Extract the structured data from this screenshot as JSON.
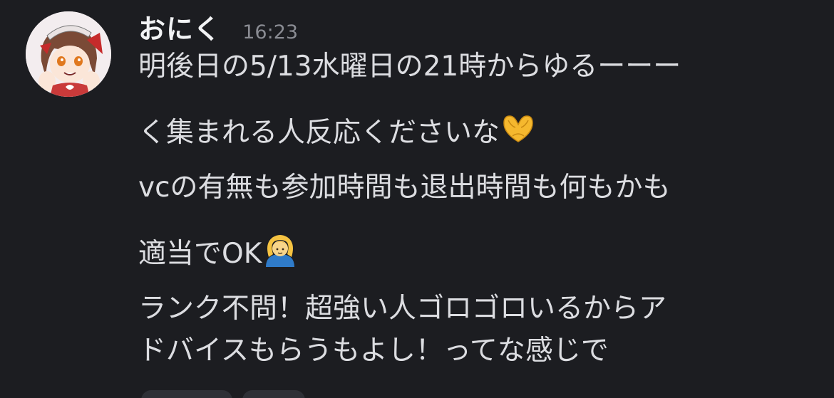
{
  "message": {
    "username": "おにく",
    "timestamp": "16:23",
    "lines": [
      {
        "text": "明後日の5/13水曜日の21時からゆるーーー",
        "emoji": ""
      },
      {
        "text": "く集まれる人反応くださいな",
        "emoji": "heart-hands-emoji"
      },
      {
        "text": "vcの有無も参加時間も退出時間も何もかも",
        "emoji": ""
      },
      {
        "text": "適当でOK",
        "emoji": "person-gesturing-ok-emoji"
      },
      {
        "text": "ランク不問！超強い人ゴロゴロいるからア",
        "emoji": ""
      },
      {
        "text": "ドバイスもらうもよし！ってな感じで",
        "emoji": ""
      }
    ],
    "avatar_icon": "user-avatar-anime-character",
    "reactions_visible": 2
  },
  "colors": {
    "background": "#1c1d21",
    "username": "#f2f3f5",
    "text": "#dcdde1",
    "timestamp": "#8a8c93",
    "reaction_bg": "#2e3036"
  }
}
